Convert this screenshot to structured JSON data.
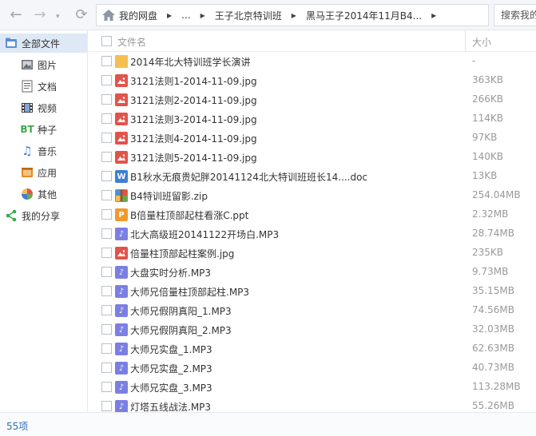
{
  "nav": {
    "back": "←",
    "forward": "→",
    "refresh": "⟳",
    "dropdown": "▾"
  },
  "breadcrumb": {
    "items": [
      "我的网盘",
      "...",
      "王子北京特训班",
      "黑马王子2014年11月B4..."
    ]
  },
  "search": {
    "placeholder": "搜索我的"
  },
  "sidebar": {
    "items": [
      {
        "label": "全部文件",
        "icon": "all-files-icon"
      },
      {
        "label": "图片",
        "icon": "image-icon"
      },
      {
        "label": "文档",
        "icon": "document-icon"
      },
      {
        "label": "视频",
        "icon": "video-icon"
      },
      {
        "label": "种子",
        "icon": "torrent-icon",
        "glyph": "BT"
      },
      {
        "label": "音乐",
        "icon": "music-icon"
      },
      {
        "label": "应用",
        "icon": "app-icon"
      },
      {
        "label": "其他",
        "icon": "other-icon"
      },
      {
        "label": "我的分享",
        "icon": "share-icon"
      }
    ]
  },
  "list": {
    "header": {
      "name": "文件名",
      "size": "大小"
    },
    "files": [
      {
        "name": "2014年北大特训班学长演讲",
        "size": "-",
        "type": "folder"
      },
      {
        "name": "3121法则1-2014-11-09.jpg",
        "size": "363KB",
        "type": "img"
      },
      {
        "name": "3121法则2-2014-11-09.jpg",
        "size": "266KB",
        "type": "img"
      },
      {
        "name": "3121法则3-2014-11-09.jpg",
        "size": "114KB",
        "type": "img"
      },
      {
        "name": "3121法则4-2014-11-09.jpg",
        "size": "97KB",
        "type": "img"
      },
      {
        "name": "3121法则5-2014-11-09.jpg",
        "size": "140KB",
        "type": "img"
      },
      {
        "name": "B1秋水无痕贵妃胖20141124北大特训班班长14....doc",
        "size": "13KB",
        "type": "doc",
        "glyph": "W"
      },
      {
        "name": "B4特训班留影.zip",
        "size": "254.04MB",
        "type": "zip"
      },
      {
        "name": "B倍量柱顶部起柱看涨C.ppt",
        "size": "2.32MB",
        "type": "ppt",
        "glyph": "P"
      },
      {
        "name": "北大高级班20141122开场白.MP3",
        "size": "28.74MB",
        "type": "mp3"
      },
      {
        "name": "倍量柱顶部起柱案例.jpg",
        "size": "235KB",
        "type": "img"
      },
      {
        "name": "大盘实时分析.MP3",
        "size": "9.73MB",
        "type": "mp3"
      },
      {
        "name": "大师兄倍量柱顶部起柱.MP3",
        "size": "35.15MB",
        "type": "mp3"
      },
      {
        "name": "大师兄假阴真阳_1.MP3",
        "size": "74.56MB",
        "type": "mp3"
      },
      {
        "name": "大师兄假阴真阳_2.MP3",
        "size": "32.03MB",
        "type": "mp3"
      },
      {
        "name": "大师兄实盘_1.MP3",
        "size": "62.63MB",
        "type": "mp3"
      },
      {
        "name": "大师兄实盘_2.MP3",
        "size": "40.73MB",
        "type": "mp3"
      },
      {
        "name": "大师兄实盘_3.MP3",
        "size": "113.28MB",
        "type": "mp3"
      },
      {
        "name": "灯塔五线战法.MP3",
        "size": "55.26MB",
        "type": "mp3"
      }
    ]
  },
  "status": {
    "count": "55项"
  },
  "colors": {
    "folder": "#f5bf4f",
    "img": "#e2534b",
    "doc": "#3f7fd4",
    "zip": "#6aa84f",
    "ppt": "#f09a2a",
    "mp3": "#7b7fe3",
    "active_bg": "#dfe8f5",
    "link": "#2f6fb8"
  }
}
